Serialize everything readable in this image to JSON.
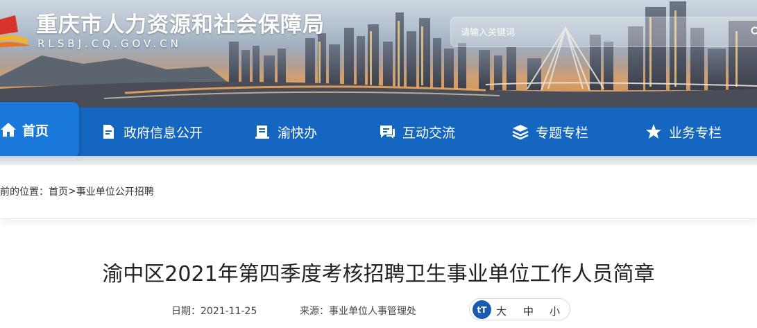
{
  "header": {
    "site_title": "重庆市人力资源和社会保障局",
    "site_domain": "RLSBJ.CQ.GOV.CN",
    "search_placeholder": "请输入关键词"
  },
  "nav": {
    "home": "首页",
    "items": [
      {
        "label": "政府信息公开",
        "icon": "document-icon"
      },
      {
        "label": "渝快办",
        "icon": "book-icon"
      },
      {
        "label": "互动交流",
        "icon": "chat-icon"
      },
      {
        "label": "专题专栏",
        "icon": "layers-icon"
      },
      {
        "label": "业务专栏",
        "icon": "star-icon"
      }
    ]
  },
  "breadcrumb": {
    "prefix": "前的位置：",
    "home": "首页",
    "separator": ">",
    "current": "事业单位公开招聘"
  },
  "article": {
    "title": "渝中区2021年第四季度考核招聘卫生事业单位工作人员简章",
    "date_label": "日期：",
    "date": "2021-11-25",
    "source_label": "来源：",
    "source": "事业单位人事管理处",
    "font_badge": "tT",
    "font_large": "大",
    "font_medium": "中",
    "font_small": "小"
  },
  "colors": {
    "nav_bg": "#1566c0",
    "nav_active": "#1a78db"
  }
}
